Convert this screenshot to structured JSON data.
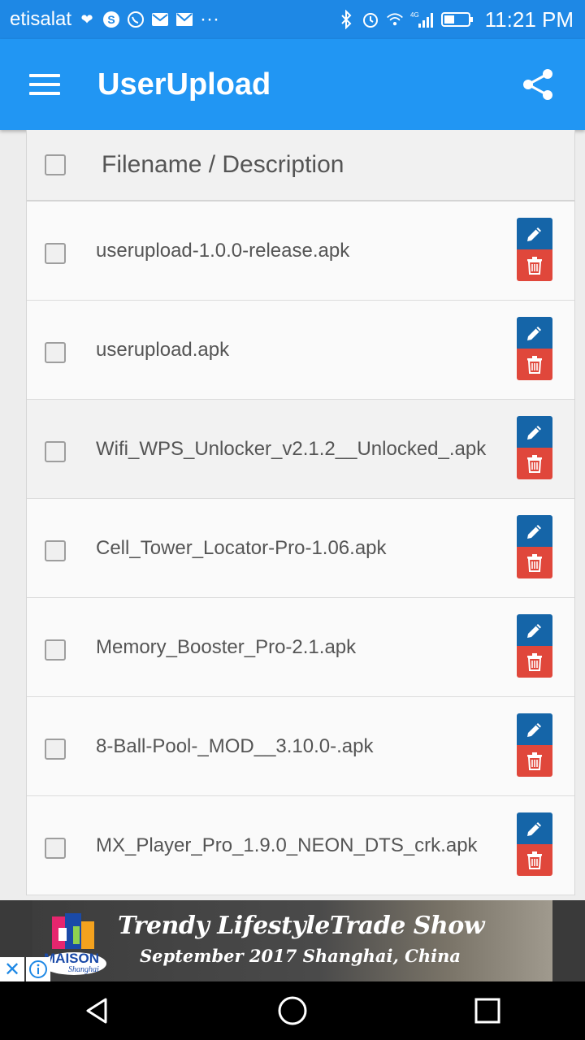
{
  "status_bar": {
    "carrier": "etisalat",
    "time": "11:21 PM",
    "more": "···",
    "network": "4G"
  },
  "appbar": {
    "title": "UserUpload"
  },
  "table": {
    "header": "Filename / Description",
    "rows": [
      {
        "filename": "userupload-1.0.0-release.apk"
      },
      {
        "filename": "userupload.apk"
      },
      {
        "filename": "Wifi_WPS_Unlocker_v2.1.2__Unlocked_.apk"
      },
      {
        "filename": "Cell_Tower_Locator-Pro-1.06.apk"
      },
      {
        "filename": "Memory_Booster_Pro-2.1.apk"
      },
      {
        "filename": "8-Ball-Pool-_MOD__3.10.0-.apk"
      },
      {
        "filename": "MX_Player_Pro_1.9.0_NEON_DTS_crk.apk"
      }
    ]
  },
  "ad": {
    "title": "Trendy LifestyleTrade Show",
    "subtitle": "September 2017  Shanghai, China",
    "brand": "MAISON",
    "brand_sub": "Shanghai"
  },
  "colors": {
    "appbar": "#2196f3",
    "statusbar": "#1e88e5",
    "edit": "#1565a8",
    "delete": "#e0473b"
  }
}
